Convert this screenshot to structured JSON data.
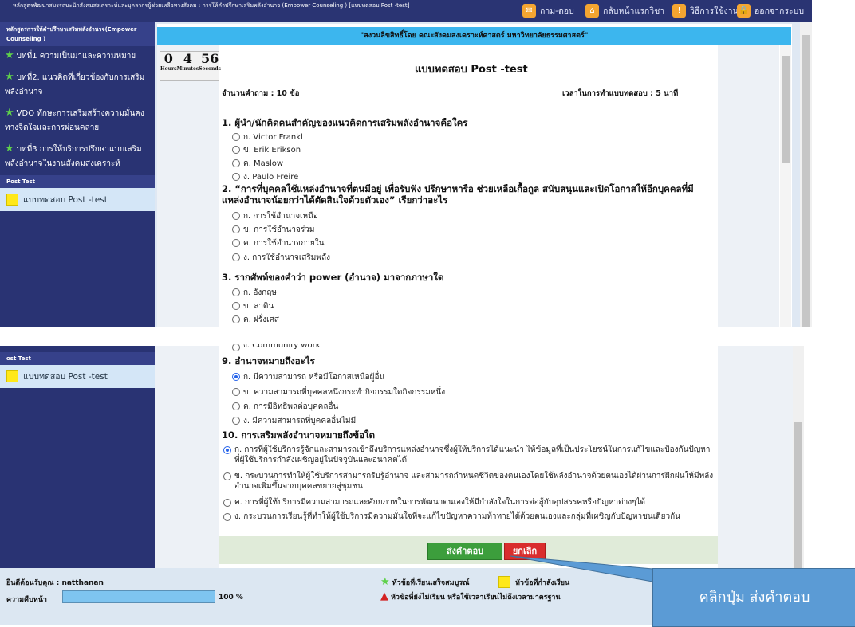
{
  "top": {
    "breadcrumb": "หลักสูตรพัฒนาสมรรถนะนักสังคมสงเคราะห์และบุคลากรผู้ช่วยเหลือทางสังคม : การให้คำปรึกษาเสริมพลังอำนาจ (Empower Counseling ) [แบบทดสอบ Post -test]",
    "nav": [
      {
        "label": "ถาม-ตอบ",
        "icon": "chat-icon"
      },
      {
        "label": "กลับหน้าแรกวิชา",
        "icon": "home-icon"
      },
      {
        "label": "วิธีการใช้งาน",
        "icon": "info-icon"
      },
      {
        "label": "ออกจากระบบ",
        "icon": "lock-icon"
      }
    ]
  },
  "sidebar": {
    "course_title": "หลักสูตรการให้คำปรึกษาเสริมพลังอำนาจ(Empower Counseling )",
    "items": [
      "บทที่1 ความเป็นมาและความหมาย",
      "บทที่2. แนวคิดที่เกี่ยวข้องกับการเสริมพลังอำนาจ",
      "VDO ทักษะการเสริมสร้างความมั่นคงทางจิตใจและการผ่อนคลาย",
      "บทที่3 การให้บริการปรึกษาแบบเสริมพลังอำนาจในงานสังคมสงเคราะห์"
    ],
    "section": "Post Test",
    "active_item": "แบบทดสอบ Post -test",
    "section_cropped": "ost Test"
  },
  "banner": "\"สงวนลิขสิทธิ์โดย คณะสังคมสงเคราะห์ศาสตร์ มหาวิทยาลัยธรรมศาสตร์\"",
  "timer": {
    "hours": "0",
    "minutes": "4",
    "seconds": "56",
    "hours_lbl": "Hours",
    "minutes_lbl": "Minutes",
    "seconds_lbl": "Seconds"
  },
  "exam": {
    "title": "แบบทดสอบ Post -test",
    "count": "จำนวนคำถาม : 10 ข้อ",
    "time": "เวลาในการทำแบบทดสอบ : 5 นาที"
  },
  "q1": {
    "text": "1.  ผู้นำ/นักคิดคนสำคัญของแนวคิดการเสริมพลังอำนาจคือใคร",
    "options": [
      "ก. Victor Frankl",
      "ข. Erik Erikson",
      "ค. Maslow",
      "ง. Paulo Freire"
    ]
  },
  "q2": {
    "text": "2.  “การที่บุคคลใช้แหล่งอำนาจที่ตนมีอยู่ เพื่อรับฟัง ปรึกษาหารือ ช่วยเหลือเกื้อกูล สนับสนุนและเปิดโอกาสให้อีกบุคคลที่มีแหล่งอำนาจน้อยกว่าได้ตัดสินใจด้วยตัวเอง” เรียกว่าอะไร",
    "options": [
      "ก. การใช้อำนาจเหนือ",
      "ข. การใช้อำนาจร่วม",
      "ค. การใช้อำนาจภายใน",
      "ง. การใช้อำนาจเสริมพลัง"
    ]
  },
  "q3": {
    "text": "3.  รากศัพท์ของคำว่า power (อำนาจ) มาจากภาษาใด",
    "options": [
      "ก. อังกฤษ",
      "ข. ลาติน",
      "ค. ฝรั่งเศส"
    ]
  },
  "q8_tail": "ง. Community work",
  "q9": {
    "text": "9.  อำนาจหมายถึงอะไร",
    "options": [
      "ก. มีความสามารถ หรือมีโอกาสเหนือผู้อื่น",
      "ข. ความสามารถที่บุคคลหนึ่งกระทำกิจกรรมใดกิจกรรมหนึ่ง",
      "ค. การมีอิทธิพลต่อบุคคลอื่น",
      "ง. มีความสามารถที่บุคคลอื่นไม่มี"
    ],
    "selected": 0
  },
  "q10": {
    "text": "10.  การเสริมพลังอำนาจหมายถึงข้อใด",
    "options": [
      "ก. การที่ผู้ใช้บริการรู้จักและสามารถเข้าถึงบริการแหล่งอำนาจซึ่งผู้ให้บริการได้แนะนำ ให้ข้อมูลที่เป็นประโยชน์ในการแก้ไขและป้องกันปัญหาที่ผู้ใช้บริการกำลังเผชิญอยู่ในปัจจุบันและอนาคตได้",
      "ข. กระบวนการทำให้ผู้ใช้บริการสามารถรับรู้อำนาจ และสามารถกำหนดชีวิตของตนเองโดยใช้พลังอำนาจด้วยตนเองได้ผ่านการฝึกฝนให้มีพลังอำนาจเพิ่มขึ้นจากบุคคลขยายสู่ชุมชน",
      "ค. การที่ผู้ใช้บริการมีความสามารถและศักยภาพในการพัฒนาตนเองให้มีกำลังใจในการต่อสู้กับอุปสรรคหรือปัญหาต่างๆได้",
      "ง. กระบวนการเรียนรู้ที่ทำให้ผู้ใช้บริการมีความมั่นใจที่จะแก้ไขปัญหาความท้าทายได้ด้วยตนเองและกลุ่มที่เผชิญกับปัญหาชนเดียวกัน"
    ],
    "selected": 0
  },
  "buttons": {
    "submit": "ส่งคำตอบ",
    "cancel": "ยกเลิก"
  },
  "footer": {
    "welcome": "ยินดีต้อนรับคุณ : natthanan",
    "progress_label": "ความคืบหน้า",
    "progress_value": "100 %",
    "progress_fraction": 1.0,
    "legend_done": "หัวข้อที่เรียนเสร็จสมบูรณ์",
    "legend_current": "หัวข้อที่กำลังเรียน",
    "legend_pending": "หัวข้อที่ยังไม่เรียน หรือใช้เวลาเรียนไม่ถึงเวลามาตรฐาน"
  },
  "callout": "คลิกปุ่ม ส่งคำตอบ"
}
